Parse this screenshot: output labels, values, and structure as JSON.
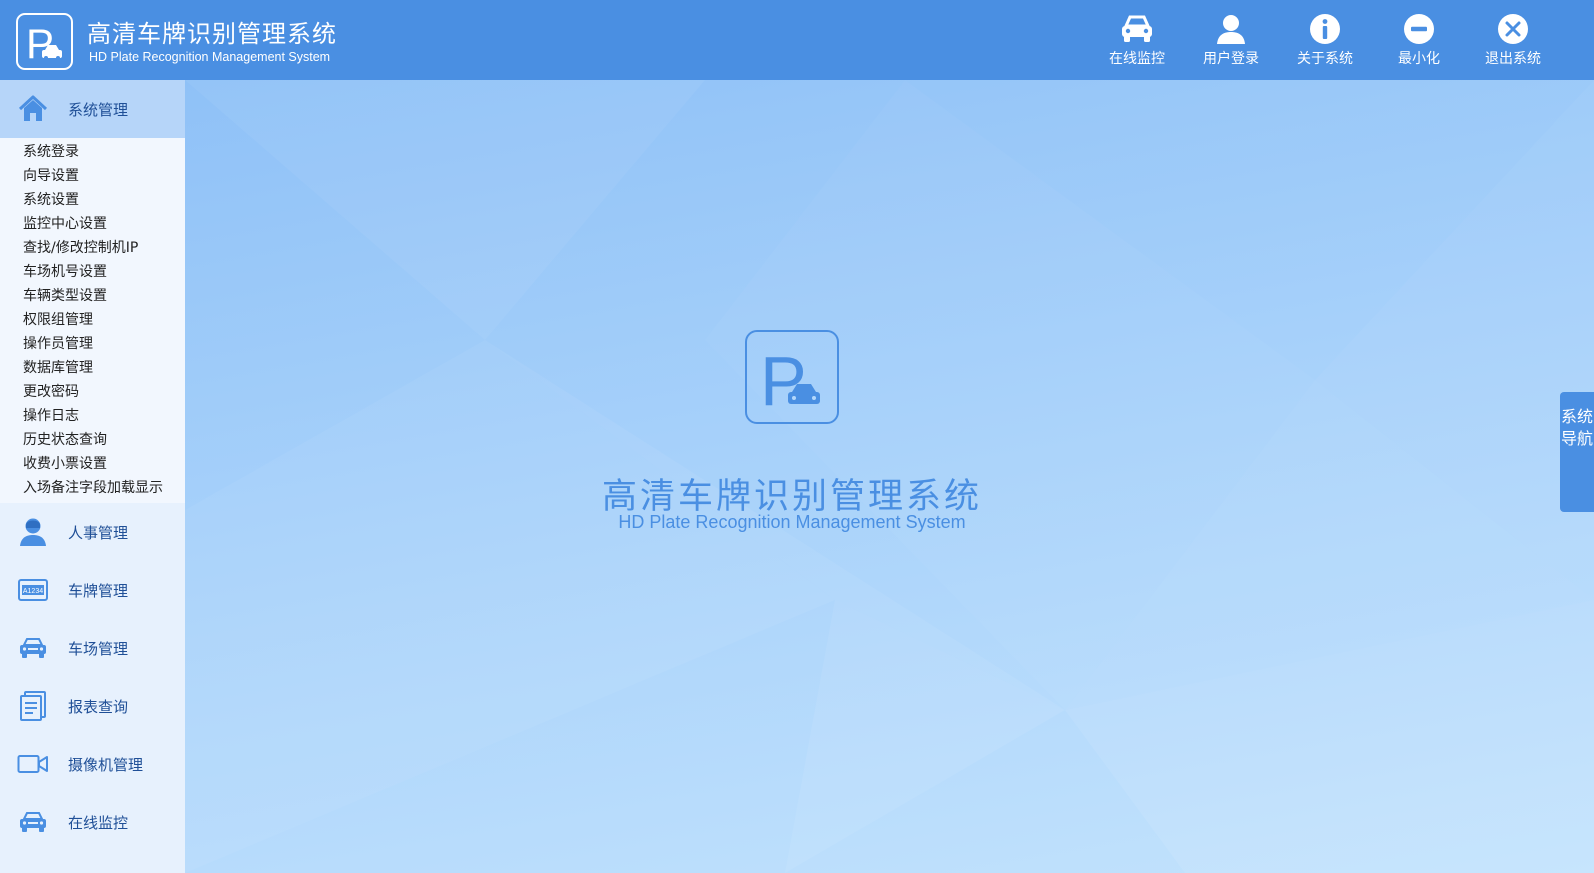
{
  "app": {
    "title": "高清车牌识别管理系统",
    "subtitle": "HD Plate Recognition Management System"
  },
  "header": {
    "actions": [
      {
        "label": "在线监控",
        "icon": "car-icon"
      },
      {
        "label": "用户登录",
        "icon": "user-icon"
      },
      {
        "label": "关于系统",
        "icon": "info-icon"
      },
      {
        "label": "最小化",
        "icon": "minimize-icon"
      },
      {
        "label": "退出系统",
        "icon": "close-icon"
      }
    ]
  },
  "sidebar": {
    "groups": [
      {
        "label": "系统管理",
        "icon": "home-icon",
        "expanded": true
      },
      {
        "label": "人事管理",
        "icon": "person-icon"
      },
      {
        "label": "车牌管理",
        "icon": "license-plate-icon"
      },
      {
        "label": "车场管理",
        "icon": "car-icon"
      },
      {
        "label": "报表查询",
        "icon": "report-icon"
      },
      {
        "label": "摄像机管理",
        "icon": "camera-icon"
      },
      {
        "label": "在线监控",
        "icon": "car-icon"
      }
    ],
    "system_items": [
      "系统登录",
      "向导设置",
      "系统设置",
      "监控中心设置",
      "查找/修改控制机IP",
      "车场机号设置",
      "车辆类型设置",
      "权限组管理",
      "操作员管理",
      "数据库管理",
      "更改密码",
      "操作日志",
      "历史状态查询",
      "收费小票设置",
      "入场备注字段加载显示"
    ],
    "plate_icon_text": "A1234"
  },
  "side_tab": {
    "label": "系统导航"
  },
  "colors": {
    "header": "#4a8fe2",
    "sidebar": "#e7f1fd",
    "active_group": "#b6d5f9",
    "accent": "#4a8fe2"
  }
}
